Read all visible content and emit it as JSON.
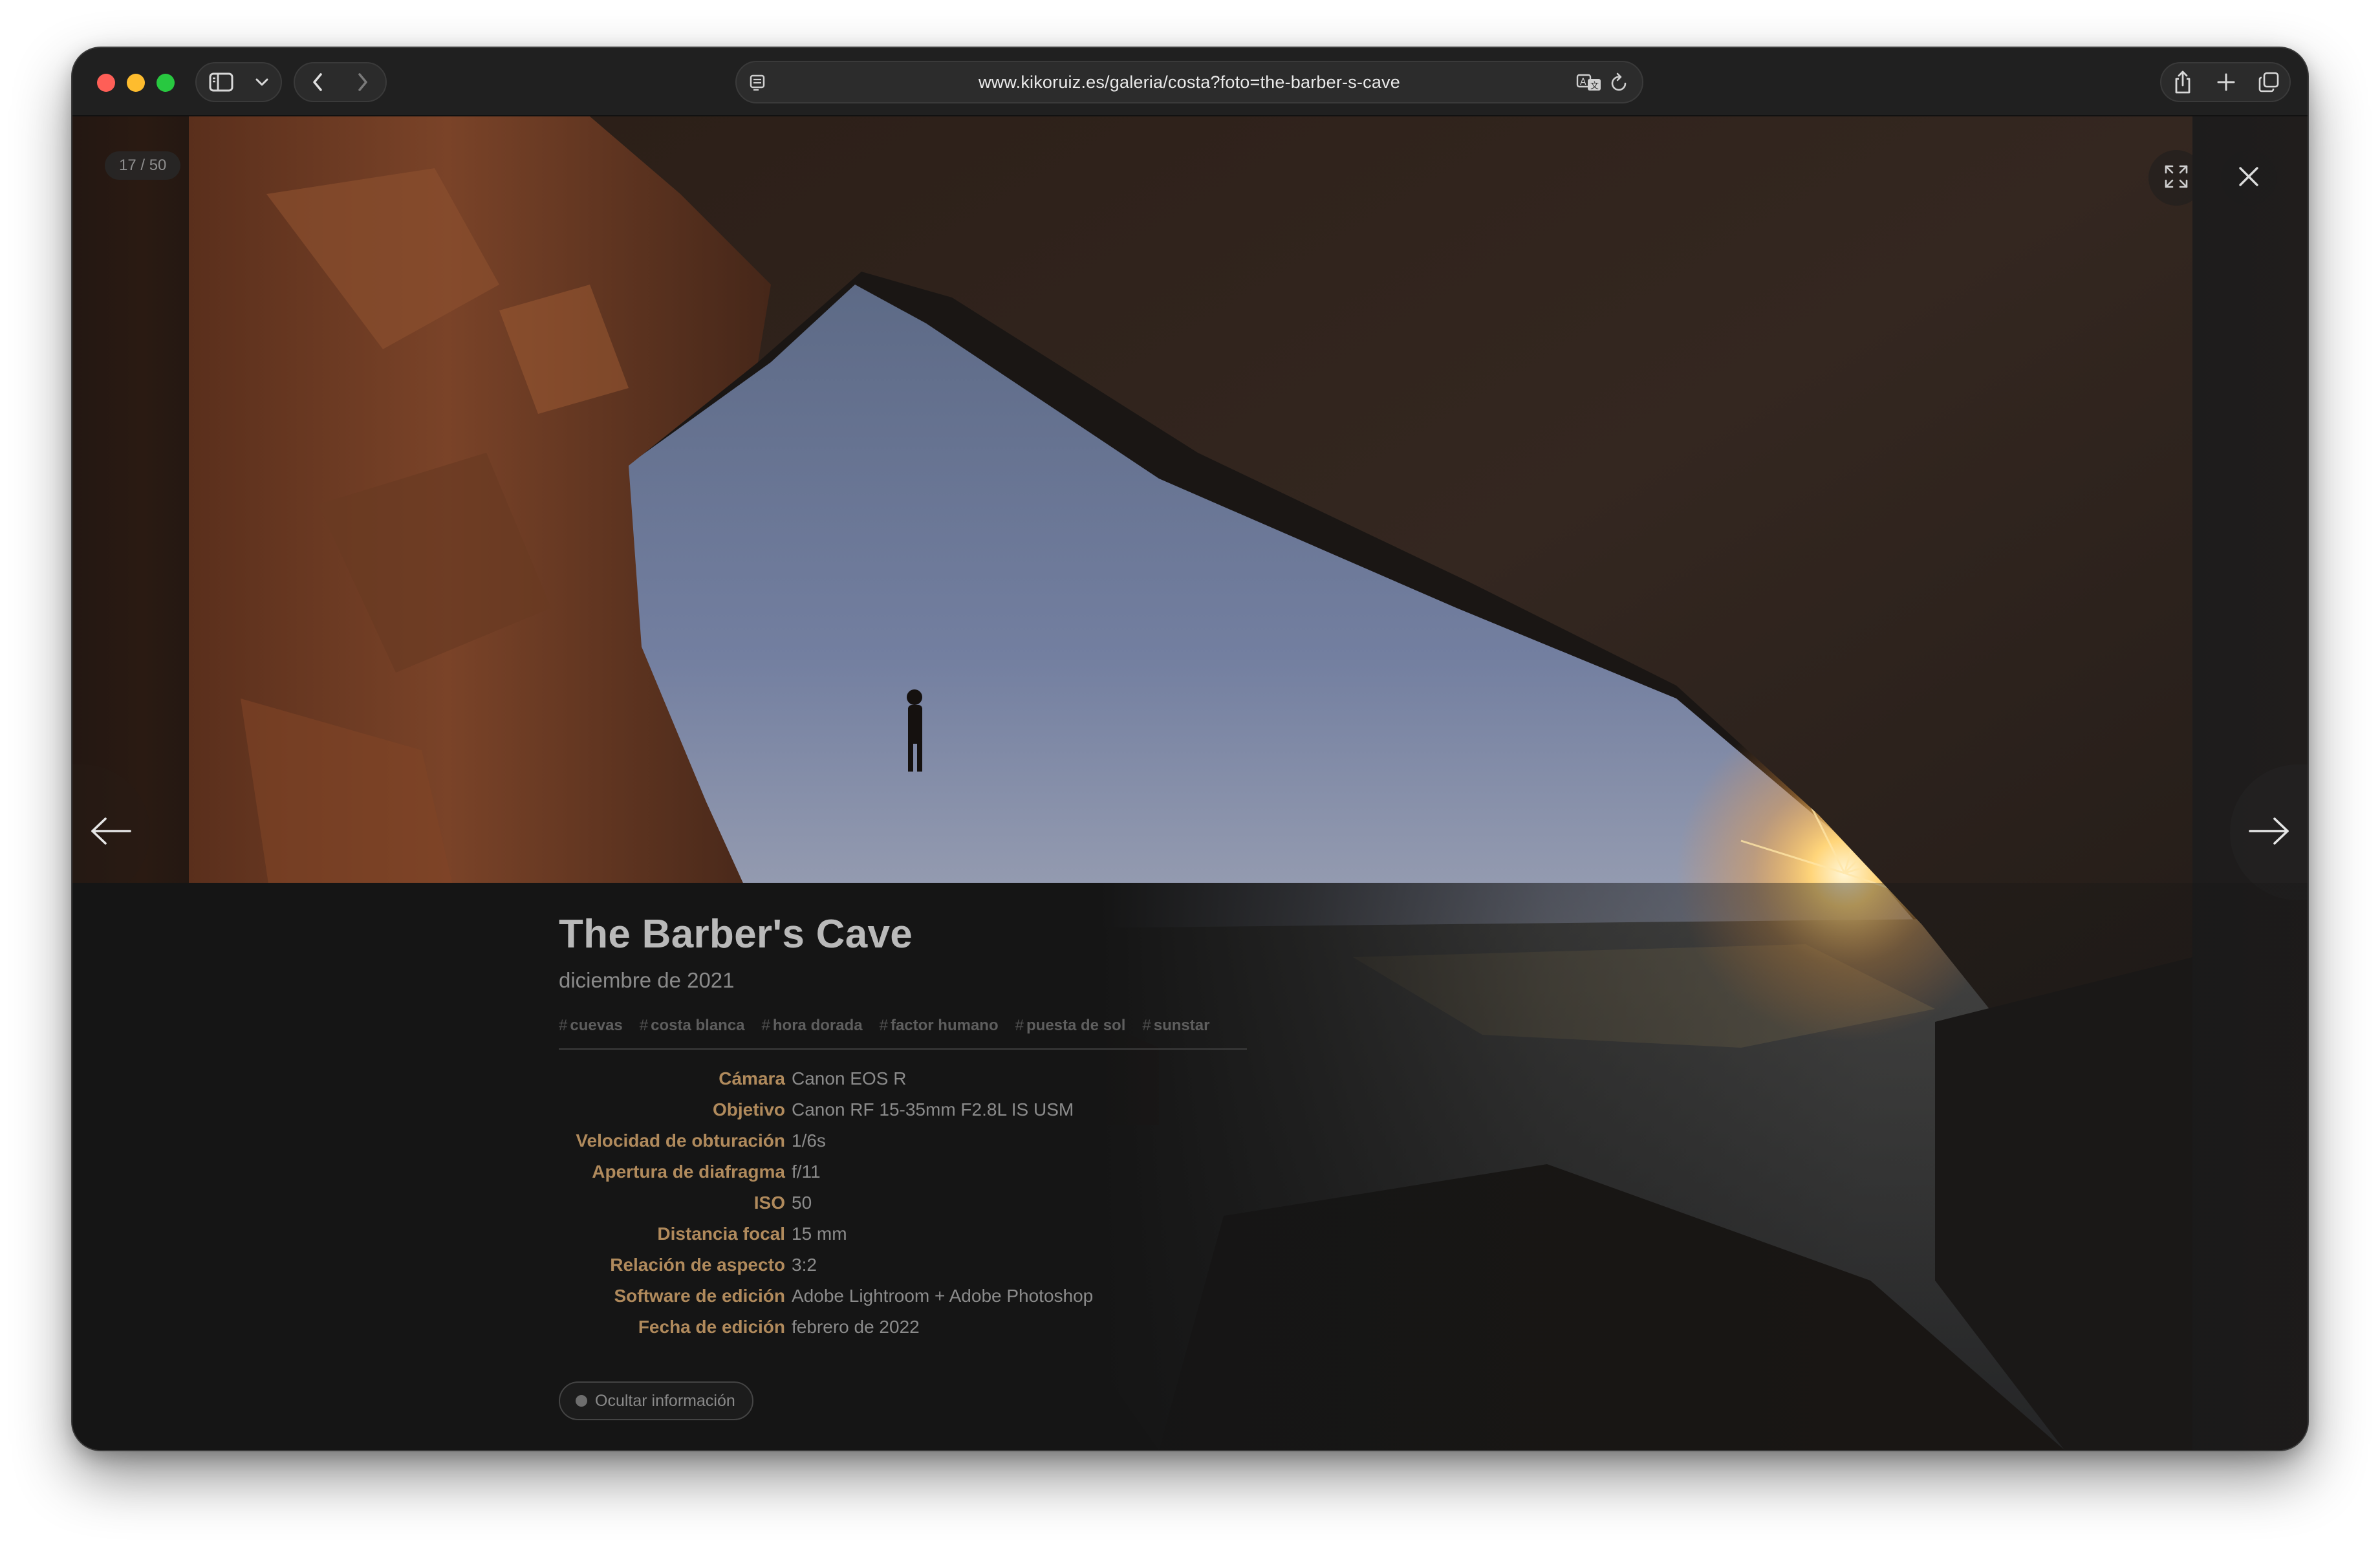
{
  "browser": {
    "url": "www.kikoruiz.es/galeria/costa?foto=the-barber-s-cave"
  },
  "viewer": {
    "counter": "17 / 50",
    "icons": {
      "fullscreen": "expand-icon",
      "close": "close-icon",
      "prev": "arrow-left-icon",
      "next": "arrow-right-icon"
    }
  },
  "photo": {
    "title": "The Barber's Cave",
    "date": "diciembre de 2021",
    "tags": [
      {
        "hash": "#",
        "label": "cuevas"
      },
      {
        "hash": "#",
        "label": "costa blanca"
      },
      {
        "hash": "#",
        "label": "hora dorada"
      },
      {
        "hash": "#",
        "label": "factor humano"
      },
      {
        "hash": "#",
        "label": "puesta de sol"
      },
      {
        "hash": "#",
        "label": "sunstar"
      }
    ],
    "specs": [
      {
        "label": "Cámara",
        "value": "Canon EOS R"
      },
      {
        "label": "Objetivo",
        "value": "Canon RF 15-35mm F2.8L IS USM"
      },
      {
        "label": "Velocidad de obturación",
        "value": "1/6s"
      },
      {
        "label": "Apertura de diafragma",
        "value": "f/11"
      },
      {
        "label": "ISO",
        "value": "50"
      },
      {
        "label": "Distancia focal",
        "value": "15 mm"
      },
      {
        "label": "Relación de aspecto",
        "value": "3:2"
      },
      {
        "label": "Software de edición",
        "value": "Adobe Lightroom + Adobe Photoshop"
      },
      {
        "label": "Fecha de edición",
        "value": "febrero de 2022"
      }
    ],
    "hide_info_label": "Ocultar información"
  },
  "colors": {
    "spec_label": "#b08a5c",
    "spec_value": "#8b8b8b",
    "panel_bg": "#151515"
  }
}
